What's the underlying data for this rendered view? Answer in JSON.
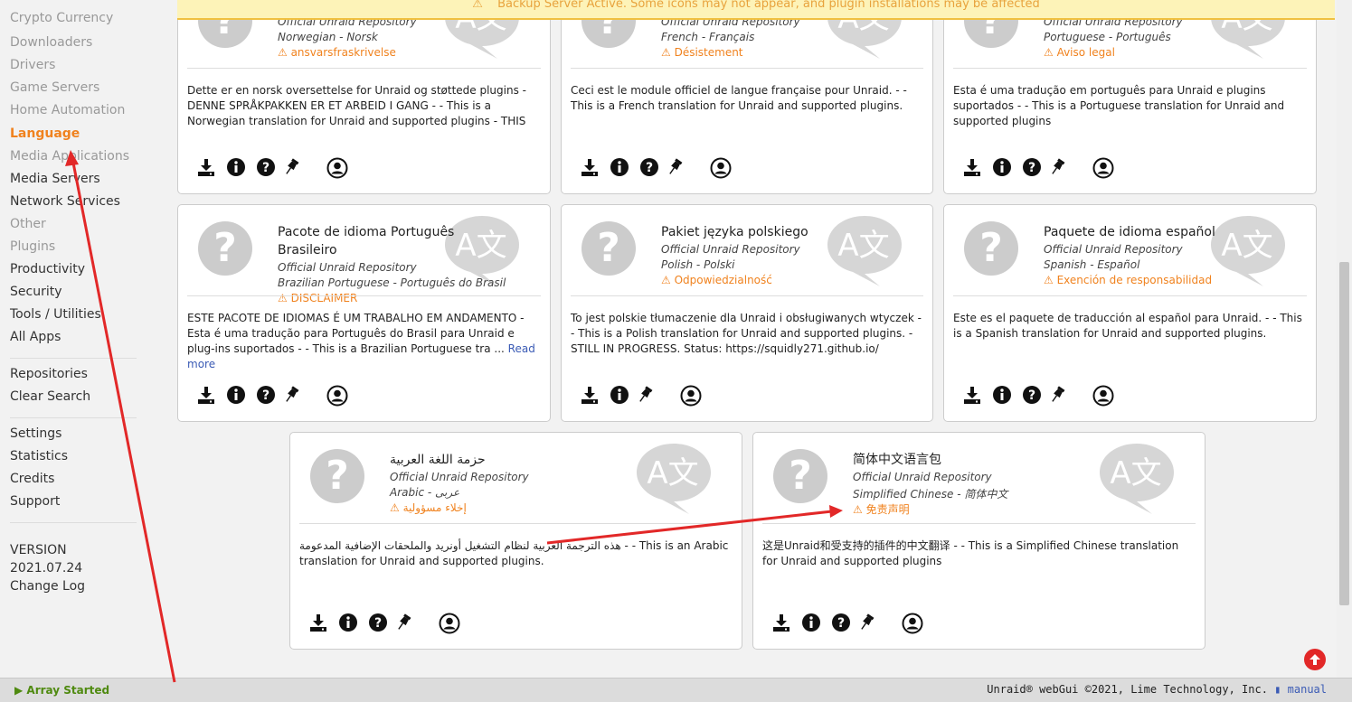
{
  "banner": {
    "text": "Backup Server Active. Some icons may not appear, and plugin installations may be affected"
  },
  "sidebar": {
    "categories": [
      {
        "label": "Crypto Currency",
        "state": "dim"
      },
      {
        "label": "Downloaders",
        "state": "dim"
      },
      {
        "label": "Drivers",
        "state": "dim"
      },
      {
        "label": "Game Servers",
        "state": "dim"
      },
      {
        "label": "Home Automation",
        "state": "dim"
      },
      {
        "label": "Language",
        "state": "active"
      },
      {
        "label": "Media Applications",
        "state": "dim"
      },
      {
        "label": "Media Servers",
        "state": "normal"
      },
      {
        "label": "Network Services",
        "state": "normal"
      },
      {
        "label": "Other",
        "state": "dim"
      },
      {
        "label": "Plugins",
        "state": "dim"
      },
      {
        "label": "Productivity",
        "state": "normal"
      },
      {
        "label": "Security",
        "state": "normal"
      },
      {
        "label": "Tools / Utilities",
        "state": "normal"
      },
      {
        "label": "All Apps",
        "state": "normal"
      }
    ],
    "links1": [
      "Repositories",
      "Clear Search"
    ],
    "links2": [
      "Settings",
      "Statistics",
      "Credits",
      "Support"
    ],
    "version_label": "VERSION",
    "version_value": "2021.07.24",
    "changelog": "Change Log"
  },
  "cards": [
    {
      "title": "",
      "repo": "Official Unraid Repository",
      "lang": "Norwegian - Norsk",
      "disclaimer": "ansvarsfraskrivelse",
      "desc": "Dette er en norsk oversettelse for Unraid og støttede plugins - DENNE SPRÅKPAKKEN ER ET ARBEID I GANG - - This is a Norwegian translation for Unraid and supported plugins - THIS",
      "more": "",
      "actions": [
        "download-icon",
        "info-icon",
        "support-icon",
        "pin-icon",
        "profile-icon"
      ]
    },
    {
      "title": "",
      "repo": "Official Unraid Repository",
      "lang": "French - Français",
      "disclaimer": "Désistement",
      "desc": "Ceci est le module officiel de langue française pour Unraid. - - This is a French translation for Unraid and supported plugins.",
      "more": "",
      "actions": [
        "download-icon",
        "info-icon",
        "support-icon",
        "pin-icon",
        "profile-icon"
      ]
    },
    {
      "title": "",
      "repo": "Official Unraid Repository",
      "lang": "Portuguese - Português",
      "disclaimer": "Aviso legal",
      "desc": "Esta é uma tradução em português para Unraid e plugins suportados - - This is a Portuguese translation for Unraid and supported plugins",
      "more": "",
      "actions": [
        "download-icon",
        "info-icon",
        "support-icon",
        "pin-icon",
        "profile-icon"
      ]
    },
    {
      "title": "Pacote de idioma Português Brasileiro",
      "repo": "Official Unraid Repository",
      "lang": "Brazilian Portuguese - Português do Brasil",
      "disclaimer": "DISCLAIMER",
      "desc": "ESTE PACOTE DE IDIOMAS É UM TRABALHO EM ANDAMENTO - Esta é uma tradução para Português do Brasil para Unraid e plug-ins suportados - - This is a Brazilian Portuguese tra ... ",
      "more": "Read more",
      "actions": [
        "download-icon",
        "info-icon",
        "support-icon",
        "pin-icon",
        "profile-icon"
      ]
    },
    {
      "title": "Pakiet języka polskiego",
      "repo": "Official Unraid Repository",
      "lang": "Polish - Polski",
      "disclaimer": "Odpowiedzialność",
      "desc": "To jest polskie tłumaczenie dla Unraid i obsługiwanych wtyczek - - This is a Polish translation for Unraid and supported plugins. - STILL IN PROGRESS. Status: https://squidly271.github.io/",
      "more": "",
      "actions": [
        "download-icon",
        "info-icon",
        "pin-icon",
        "profile-icon"
      ]
    },
    {
      "title": "Paquete de idioma español",
      "repo": "Official Unraid Repository",
      "lang": "Spanish - Español",
      "disclaimer": "Exención de responsabilidad",
      "desc": "Este es el paquete de traducción al español para Unraid. - - This is a Spanish translation for Unraid and supported plugins.",
      "more": "",
      "actions": [
        "download-icon",
        "info-icon",
        "support-icon",
        "pin-icon",
        "profile-icon"
      ]
    },
    {
      "title": "حزمة اللغة العربية",
      "repo": "Official Unraid Repository",
      "lang": "Arabic - عربى",
      "disclaimer": "إخلاء مسؤولية",
      "desc": "هذه الترجمة العربية لنظام التشغيل أونريد والملحقات الإضافية المدعومة - - This is an Arabic translation for Unraid and supported plugins.",
      "more": "",
      "actions": [
        "download-icon",
        "info-icon",
        "support-icon",
        "pin-icon",
        "profile-icon"
      ]
    },
    {
      "title": "简体中文语言包",
      "repo": "Official Unraid Repository",
      "lang": "Simplified Chinese - 简体中文",
      "disclaimer": "免责声明",
      "desc": "这是Unraid和受支持的插件的中文翻译 - - This is a Simplified Chinese translation for Unraid and supported plugins",
      "more": "",
      "actions": [
        "download-icon",
        "info-icon",
        "support-icon",
        "pin-icon",
        "profile-icon"
      ]
    }
  ],
  "footer": {
    "status": "Array Started",
    "copyright": "Unraid® webGui ©2021, Lime Technology, Inc.",
    "manual": "manual"
  },
  "colors": {
    "accent": "#f0821e",
    "status_ok": "#4f8a10",
    "annotation": "#e22828",
    "link": "#3b5bb5"
  }
}
